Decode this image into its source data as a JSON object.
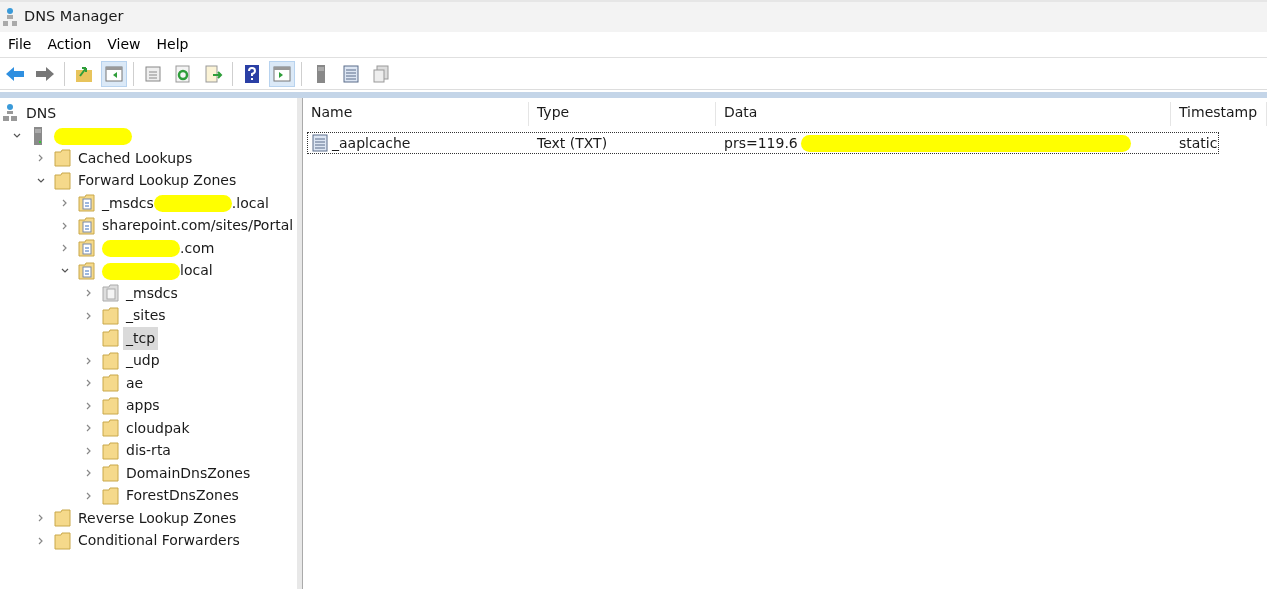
{
  "window": {
    "title": "DNS Manager"
  },
  "menu": [
    "File",
    "Action",
    "View",
    "Help"
  ],
  "toolbar": [
    {
      "kind": "back",
      "pressed": false
    },
    {
      "kind": "forward",
      "pressed": false
    },
    {
      "kind": "sep"
    },
    {
      "kind": "up-folder",
      "pressed": false
    },
    {
      "kind": "pane",
      "pressed": true
    },
    {
      "kind": "sep"
    },
    {
      "kind": "sheet",
      "pressed": false
    },
    {
      "kind": "refresh",
      "pressed": false
    },
    {
      "kind": "export",
      "pressed": false
    },
    {
      "kind": "sep"
    },
    {
      "kind": "help",
      "pressed": false
    },
    {
      "kind": "pane2",
      "pressed": true
    },
    {
      "kind": "sep"
    },
    {
      "kind": "server",
      "pressed": false
    },
    {
      "kind": "list",
      "pressed": false
    },
    {
      "kind": "copy",
      "pressed": false
    }
  ],
  "tree": [
    {
      "kind": "dns",
      "label": "DNS",
      "selected": false,
      "children": [
        {
          "kind": "server",
          "redacted": true,
          "expanded": true,
          "selected": false,
          "children": [
            {
              "kind": "folder",
              "label": "Cached Lookups",
              "expanded": false,
              "selected": false
            },
            {
              "kind": "folder",
              "label": "Forward Lookup Zones",
              "expanded": true,
              "selected": false,
              "children": [
                {
                  "kind": "zone",
                  "label": "_msdcs",
                  "redacted": true,
                  "suffix": ".local",
                  "expanded": false,
                  "selected": false
                },
                {
                  "kind": "zone",
                  "label": "sharepoint.com/sites/Portal",
                  "expanded": false,
                  "selected": false
                },
                {
                  "kind": "zone",
                  "redacted": true,
                  "suffix": ".com",
                  "expanded": false,
                  "selected": false
                },
                {
                  "kind": "zone",
                  "redacted": true,
                  "suffix": "local",
                  "expanded": true,
                  "selected": false,
                  "children": [
                    {
                      "kind": "delegation",
                      "label": "_msdcs",
                      "expanded": false,
                      "selected": false
                    },
                    {
                      "kind": "folder",
                      "label": "_sites",
                      "expanded": false,
                      "selected": false
                    },
                    {
                      "kind": "folder",
                      "label": "_tcp",
                      "selected": true
                    },
                    {
                      "kind": "folder",
                      "label": "_udp",
                      "expanded": false,
                      "selected": false
                    },
                    {
                      "kind": "folder",
                      "label": "ae",
                      "expanded": false,
                      "selected": false
                    },
                    {
                      "kind": "folder",
                      "label": "apps",
                      "expanded": false,
                      "selected": false
                    },
                    {
                      "kind": "folder",
                      "label": "cloudpak",
                      "expanded": false,
                      "selected": false
                    },
                    {
                      "kind": "folder",
                      "label": "dis-rta",
                      "expanded": false,
                      "selected": false
                    },
                    {
                      "kind": "folder",
                      "label": "DomainDnsZones",
                      "expanded": false,
                      "selected": false
                    },
                    {
                      "kind": "folder",
                      "label": "ForestDnsZones",
                      "expanded": false,
                      "selected": false
                    }
                  ]
                }
              ]
            },
            {
              "kind": "folder",
              "label": "Reverse Lookup Zones",
              "expanded": false,
              "selected": false
            },
            {
              "kind": "folder",
              "label": "Conditional Forwarders",
              "expanded": false,
              "selected": false
            }
          ]
        }
      ]
    }
  ],
  "table": {
    "columns": [
      "Name",
      "Type",
      "Data",
      "Timestamp"
    ],
    "rows": [
      {
        "name": "_aaplcache",
        "type": "Text (TXT)",
        "data": "prs=119.6",
        "data_redacted": true,
        "timestamp": "static",
        "focused": true
      }
    ]
  }
}
